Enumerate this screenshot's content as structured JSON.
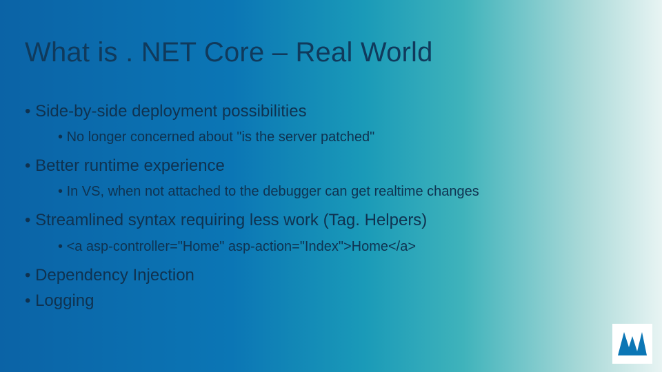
{
  "title": "What is . NET Core – Real World",
  "bullets": [
    {
      "text": "Side-by-side deployment possibilities",
      "sub": [
        "No longer concerned about \"is the server patched\""
      ]
    },
    {
      "text": "Better runtime experience",
      "sub": [
        "In VS, when not attached to the debugger can get realtime changes"
      ]
    },
    {
      "text": "Streamlined syntax requiring less work (Tag. Helpers)",
      "sub": [
        "<a asp-controller=\"Home\" asp-action=\"Index\">Home</a>"
      ]
    },
    {
      "text": "Dependency Injection",
      "sub": []
    },
    {
      "text": "Logging",
      "sub": []
    }
  ],
  "logo_name": "mva-logo"
}
